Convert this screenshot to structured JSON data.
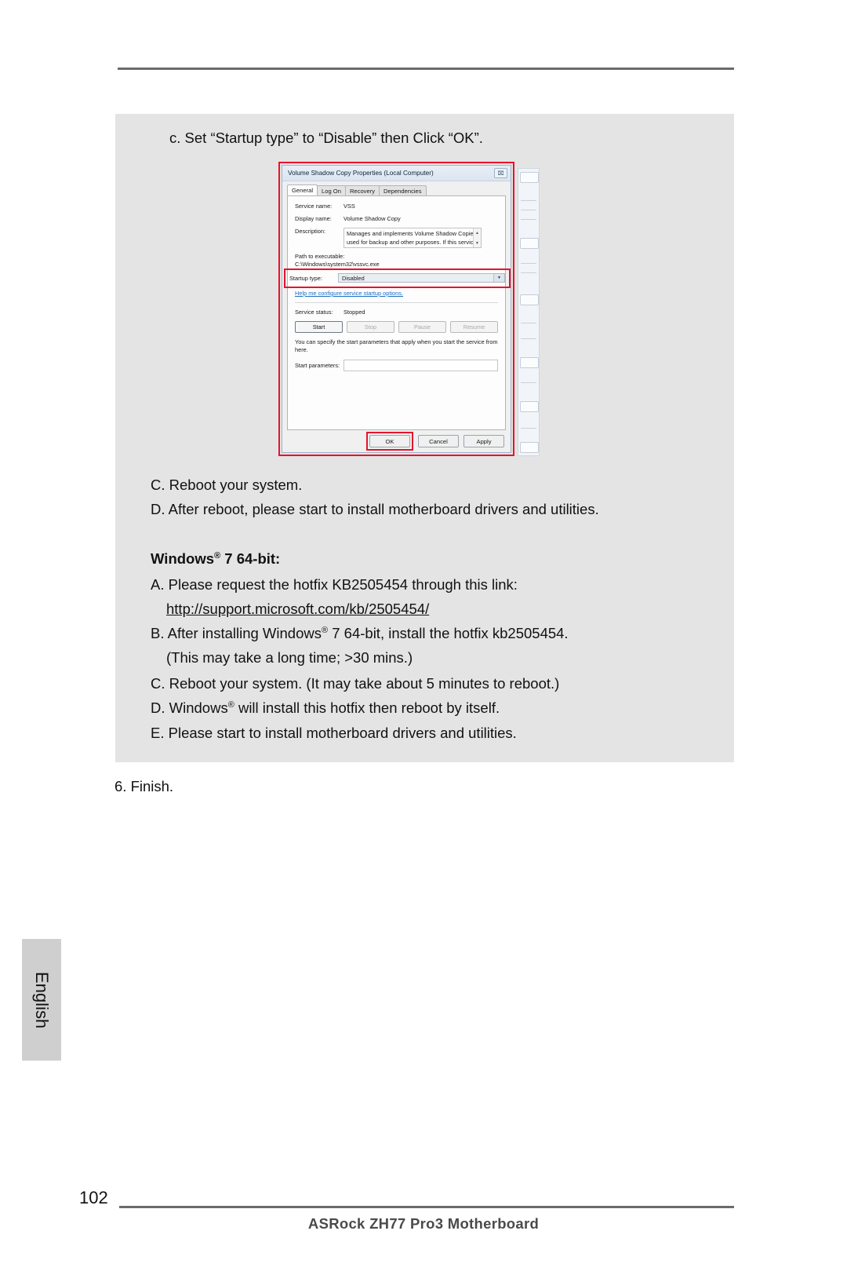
{
  "page": {
    "number": "102",
    "footer_brand": "ASRock  ZH77 Pro3  Motherboard",
    "side_tab_label": "English"
  },
  "content": {
    "step_c_caption": "c. Set “Startup type” to “Disable” then Click “OK”.",
    "after_image": [
      "C. Reboot your system.",
      "D. After reboot, please start to install motherboard drivers and utilities."
    ],
    "win7_heading_prefix": "Windows",
    "win7_heading_reg": "®",
    "win7_heading_suffix": " 7 64-bit:",
    "win7_steps": {
      "a_text": "A. Please request the hotfix KB2505454 through this link:",
      "a_link": "http://support.microsoft.com/kb/2505454/",
      "b_prefix": "B. After installing Windows",
      "b_reg": "®",
      "b_suffix": " 7 64-bit, install the hotfix kb2505454.",
      "b_note": "(This may take a long time; >30 mins.)",
      "c_text": "C. Reboot your system. (It may take about 5 minutes to reboot.)",
      "d_prefix": "D. Windows",
      "d_reg": "®",
      "d_suffix": " will install this hotfix then reboot by itself.",
      "e_text": "E. Please start to install motherboard drivers and utilities."
    },
    "finish_line": "6. Finish."
  },
  "dialog": {
    "title": "Volume Shadow Copy Properties (Local Computer)",
    "close_icon": "⌧",
    "tabs": [
      {
        "label": "General",
        "active": true
      },
      {
        "label": "Log On",
        "active": false
      },
      {
        "label": "Recovery",
        "active": false
      },
      {
        "label": "Dependencies",
        "active": false
      }
    ],
    "fields": {
      "service_name_label": "Service name:",
      "service_name_value": "VSS",
      "display_name_label": "Display name:",
      "display_name_value": "Volume Shadow Copy",
      "description_label": "Description:",
      "description_value": "Manages and implements Volume Shadow Copies used for backup and other purposes. If this service",
      "spin_up": "▲",
      "spin_down": "▼",
      "path_label": "Path to executable:",
      "path_value": "C:\\Windows\\system32\\vssvc.exe",
      "startup_type_label": "Startup type:",
      "startup_type_value": "Disabled",
      "combo_arrow": "▼",
      "help_link": "Help me configure service startup options.",
      "service_status_label": "Service status:",
      "service_status_value": "Stopped",
      "start_params_note": "You can specify the start parameters that apply when you start the service from here.",
      "start_params_label": "Start parameters:",
      "start_params_value": ""
    },
    "service_buttons": [
      {
        "label": "Start",
        "enabled": true
      },
      {
        "label": "Stop",
        "enabled": false
      },
      {
        "label": "Pause",
        "enabled": false
      },
      {
        "label": "Resume",
        "enabled": false
      }
    ],
    "footer_buttons": [
      {
        "label": "OK",
        "highlighted": true
      },
      {
        "label": "Cancel",
        "highlighted": false
      },
      {
        "label": "Apply",
        "highlighted": false
      }
    ],
    "highlight_color": "#e8122d"
  }
}
